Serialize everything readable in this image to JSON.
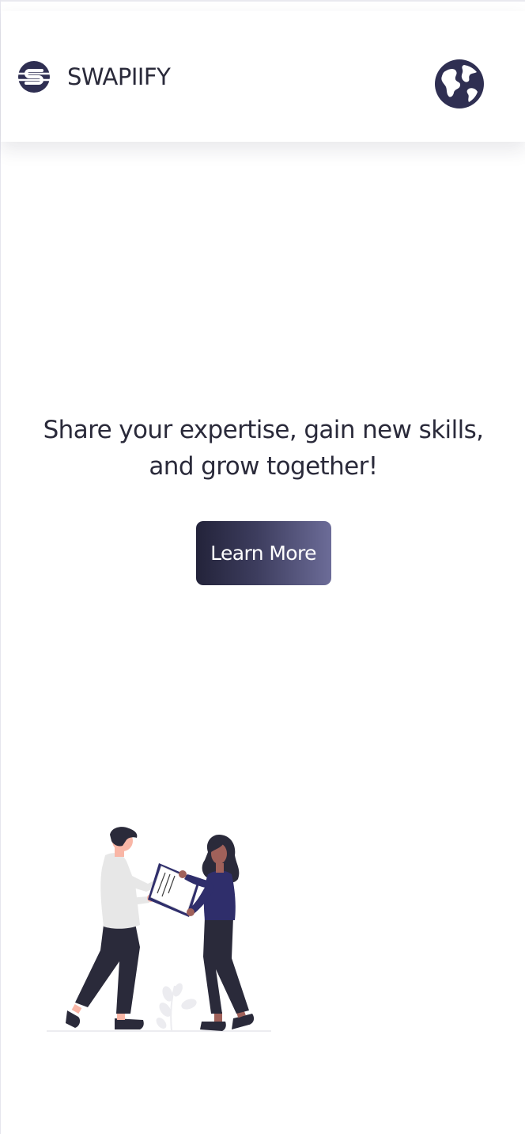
{
  "header": {
    "brand_name": "SWAPIIFY",
    "logo_icon": "swapiify-logo-icon",
    "language_icon": "globe-icon"
  },
  "hero": {
    "tagline": "Share your expertise, gain new skills, and grow together!",
    "cta_label": "Learn More"
  },
  "illustration": {
    "name": "two-people-exchanging-document-illustration"
  },
  "colors": {
    "brand_dark": "#2f2f52",
    "text": "#2a2a3a",
    "cta_gradient_start": "#23233a",
    "cta_gradient_end": "#6c6c98",
    "person_top": "#2f2e6b",
    "pants": "#2a2a3a",
    "skin_light": "#f9b6a6",
    "skin_dark": "#a0615a"
  }
}
